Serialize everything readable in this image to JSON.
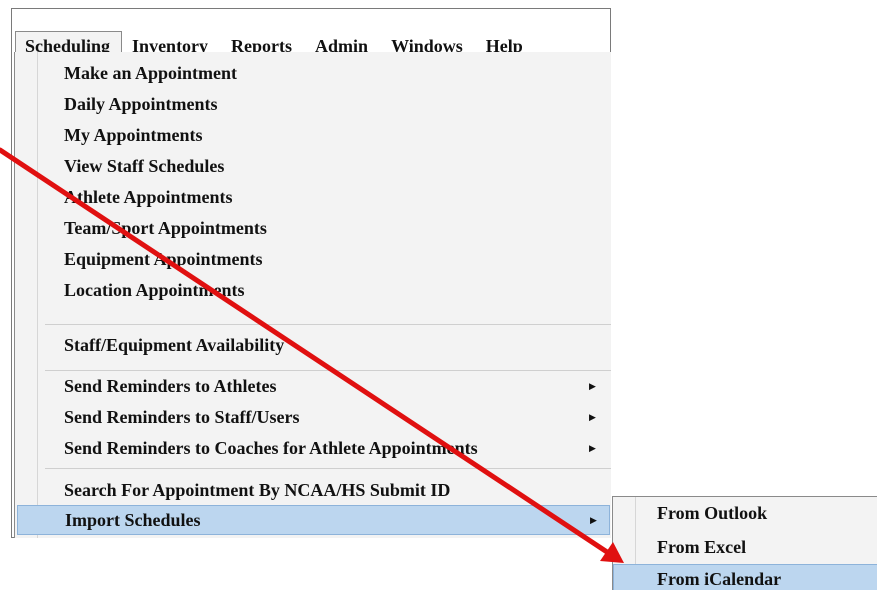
{
  "menubar": {
    "items": [
      {
        "label": "Scheduling"
      },
      {
        "label": "Inventory"
      },
      {
        "label": "Reports"
      },
      {
        "label": "Admin"
      },
      {
        "label": "Windows"
      },
      {
        "label": "Help"
      }
    ]
  },
  "scheduling_menu": {
    "items": [
      {
        "label": "Make an Appointment"
      },
      {
        "label": "Daily Appointments"
      },
      {
        "label": "My Appointments"
      },
      {
        "label": "View Staff Schedules"
      },
      {
        "label": "Athlete Appointments"
      },
      {
        "label": "Team/Sport Appointments"
      },
      {
        "label": "Equipment Appointments"
      },
      {
        "label": "Location Appointments"
      },
      {
        "label": "Staff/Equipment Availability"
      },
      {
        "label": "Send Reminders to Athletes"
      },
      {
        "label": "Send Reminders to Staff/Users"
      },
      {
        "label": "Send Reminders to Coaches for Athlete Appointments"
      },
      {
        "label": "Search For Appointment By NCAA/HS Submit ID"
      },
      {
        "label": "Import Schedules"
      }
    ]
  },
  "import_submenu": {
    "items": [
      {
        "label": "From Outlook"
      },
      {
        "label": "From Excel"
      },
      {
        "label": "From iCalendar"
      }
    ]
  },
  "colors": {
    "highlight": "#bcd6ef",
    "annotation_arrow": "#e01010"
  },
  "icons": {
    "submenu_indicator": "caret-right-icon",
    "annotation": "red-pointer-arrow"
  }
}
